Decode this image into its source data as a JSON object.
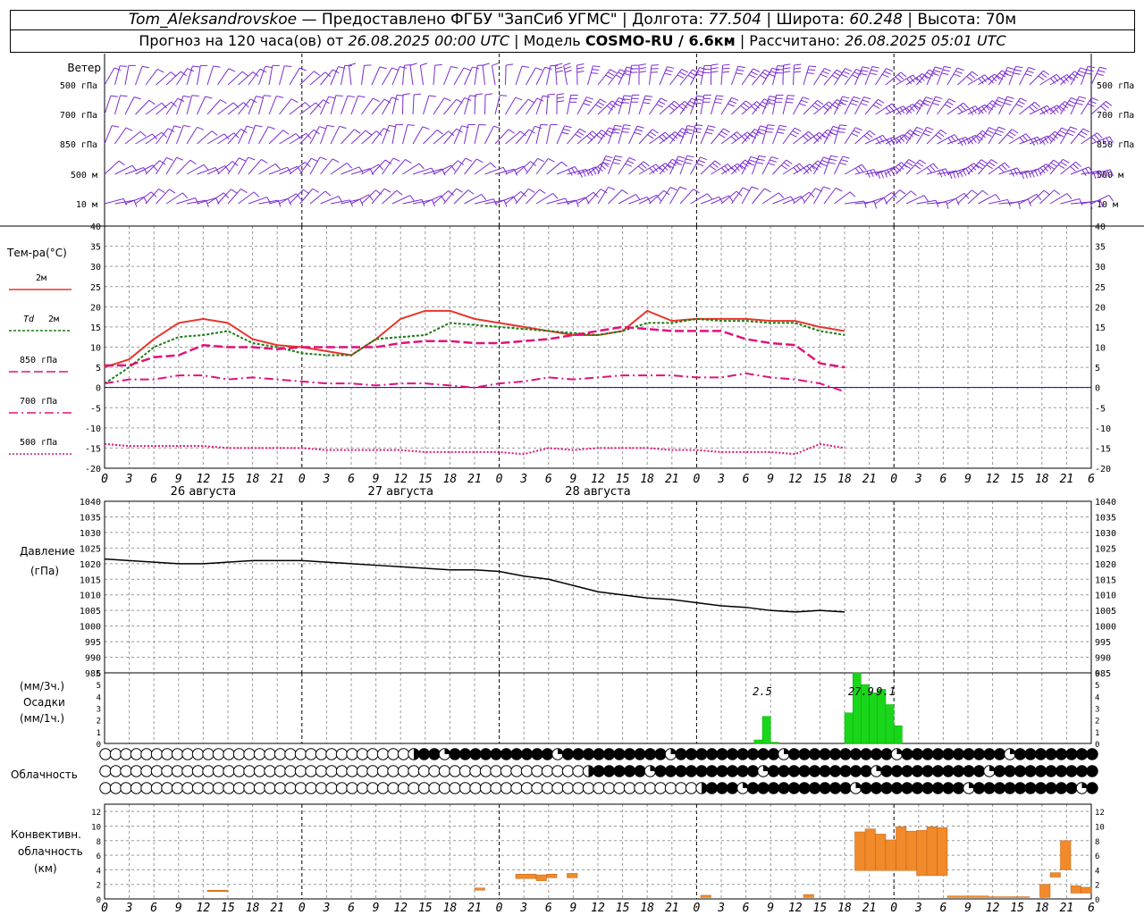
{
  "header": {
    "line1": {
      "station": "Tom_Aleksandrovskoe",
      "provided": "— Предоставлено ФГБУ \"ЗапСиб УГМС\" | Долгота:",
      "lon": "77.504",
      "lat_label": "| Широта:",
      "lat": "60.248",
      "alt_label": "| Высота:",
      "alt": "70м"
    },
    "line2": {
      "forecast_label": "Прогноз на 120 часа(ов) от",
      "forecast_time": "26.08.2025 00:00 UTC",
      "model_label": "| Модель",
      "model": "COSMO-RU / 6.6км",
      "calc_label": "| Рассчитано:",
      "calc_time": "26.08.2025 05:01 UTC"
    }
  },
  "colors": {
    "t2m": "#e8352a",
    "td2m": "#1d7a14",
    "t850": "#e0127a",
    "t700": "#e0127a",
    "t500": "#e0127a",
    "pressure": "#000000",
    "precip": "#1ad61a",
    "conv": "#f08a2a",
    "wind": "#7b2cd0",
    "zero": "#0000cc"
  },
  "wind_panel": {
    "title": "Ветер",
    "levels": [
      "500 гПа",
      "700 гПа",
      "850 гПа",
      "500 м",
      "10 м"
    ]
  },
  "x_axis": {
    "ticks": [
      "0",
      "3",
      "6",
      "9",
      "12",
      "15",
      "18",
      "21"
    ],
    "last_tick": "6",
    "dates": [
      "26 августа",
      "27 августа",
      "28 августа"
    ]
  },
  "icons": {
    "wind": "wind-barb-icon",
    "cloud": "cloud-cover-circle-icon"
  },
  "chart_data": [
    {
      "type": "line",
      "name": "temperature",
      "title": "Тем-ра(°С)",
      "ylim": [
        -20,
        40
      ],
      "yticks": [
        40,
        35,
        30,
        25,
        20,
        15,
        10,
        5,
        0,
        -5,
        -10,
        -15,
        -20
      ],
      "x": [
        0,
        3,
        6,
        9,
        12,
        15,
        18,
        21,
        24,
        27,
        30,
        33,
        36,
        39,
        42,
        45,
        48,
        51,
        54,
        57,
        60,
        63,
        66,
        69,
        72,
        75,
        78,
        81,
        84,
        87,
        90
      ],
      "series": [
        {
          "name": "2м",
          "values": [
            5,
            7,
            12,
            16,
            17,
            16,
            12,
            10.5,
            10,
            9,
            8,
            12,
            17,
            19,
            19,
            17,
            16,
            15,
            14,
            13,
            13,
            14,
            19,
            16.5,
            17,
            17,
            17,
            16.5,
            16.5,
            15,
            14
          ]
        },
        {
          "name": "Td 2м",
          "values": [
            1,
            5,
            10,
            12.5,
            13,
            14,
            11,
            10,
            8.5,
            8,
            8,
            12,
            12.5,
            13,
            16,
            15.5,
            15,
            14.5,
            14,
            13.5,
            13,
            14,
            16,
            16,
            17,
            16.5,
            16.5,
            16,
            16,
            14,
            13
          ]
        },
        {
          "name": "850 гПа",
          "values": [
            5.5,
            5.5,
            7.5,
            8,
            10.5,
            10,
            10,
            9.5,
            10,
            10,
            10,
            10,
            11,
            11.5,
            11.5,
            11,
            11,
            11.5,
            12,
            13,
            14,
            15,
            14.5,
            14,
            14,
            14,
            12,
            11,
            10.5,
            6,
            5
          ]
        },
        {
          "name": "700 гПа",
          "values": [
            1,
            2,
            2,
            3,
            3,
            2,
            2.5,
            2,
            1.5,
            1,
            1,
            0.5,
            1,
            1,
            0.5,
            0,
            1,
            1.5,
            2.5,
            2,
            2.5,
            3,
            3,
            3,
            2.5,
            2.5,
            3.5,
            2.5,
            2,
            1,
            -1
          ]
        },
        {
          "name": "500 гПа",
          "values": [
            -14,
            -14.5,
            -14.5,
            -14.5,
            -14.5,
            -15,
            -15,
            -15,
            -15,
            -15.5,
            -15.5,
            -15.5,
            -15.5,
            -16,
            -16,
            -16,
            -16,
            -16.5,
            -15,
            -15.5,
            -15,
            -15,
            -15,
            -15.5,
            -15.5,
            -16,
            -16,
            -16,
            -16.5,
            -14,
            -15
          ]
        }
      ]
    },
    {
      "type": "line",
      "name": "pressure",
      "title": "Давление",
      "unit": "(гПа)",
      "ylim": [
        985,
        1040
      ],
      "yticks": [
        1040,
        1035,
        1030,
        1025,
        1020,
        1015,
        1010,
        1005,
        1000,
        995,
        990,
        985
      ],
      "x": [
        0,
        3,
        6,
        9,
        12,
        15,
        18,
        21,
        24,
        27,
        30,
        33,
        36,
        39,
        42,
        45,
        48,
        51,
        54,
        57,
        60,
        63,
        66,
        69,
        72,
        75,
        78,
        81,
        84,
        87,
        90
      ],
      "values": [
        1021.5,
        1021,
        1020.5,
        1020,
        1020,
        1020.5,
        1021,
        1021,
        1021,
        1020.5,
        1020,
        1019.5,
        1019,
        1018.5,
        1018,
        1018,
        1017.5,
        1016,
        1015,
        1013,
        1011,
        1010,
        1009,
        1008.5,
        1007.5,
        1006.5,
        1006,
        1005,
        1004.5,
        1005,
        1004.5
      ]
    },
    {
      "type": "bar",
      "name": "precipitation",
      "title": "Осадки",
      "unit_top": "(мм/3ч.)",
      "unit_bottom": "(мм/1ч.)",
      "ylim": [
        0,
        6
      ],
      "yticks": [
        6,
        5,
        4,
        3,
        2,
        1,
        0
      ],
      "x": [
        79,
        80,
        81,
        90,
        91,
        92,
        93,
        94,
        95,
        96
      ],
      "values": [
        0.3,
        2.3,
        0.1,
        2.6,
        6,
        5,
        4.3,
        4.6,
        3.3,
        1.5
      ],
      "labels": [
        {
          "x": 80,
          "text": "2.5"
        },
        {
          "x": 92,
          "text": "27.9"
        },
        {
          "x": 95,
          "text": "9.1"
        }
      ]
    },
    {
      "type": "table",
      "name": "cloudiness",
      "title": "Облачность",
      "rows": 3,
      "steps": 97,
      "onsets": [
        {
          "low": 30,
          "mid": 47,
          "high": 58
        }
      ]
    },
    {
      "type": "bar",
      "name": "convective-cloudiness",
      "title": "Конвективн.",
      "title2": "облачность",
      "unit": "(км)",
      "ylim": [
        0,
        13
      ],
      "yticks": [
        12,
        10,
        8,
        6,
        4,
        2,
        0
      ],
      "bars": [
        [
          10,
          12,
          1,
          1.2
        ],
        [
          36,
          37,
          1.2,
          1.5
        ],
        [
          40,
          42,
          2.8,
          3.4
        ],
        [
          42,
          43,
          2.5,
          3.3
        ],
        [
          43,
          44,
          2.9,
          3.4
        ],
        [
          45,
          46,
          2.9,
          3.5
        ],
        [
          58,
          59,
          0.2,
          0.5
        ],
        [
          68,
          69,
          0.2,
          0.6
        ],
        [
          73,
          74,
          3.9,
          9.2
        ],
        [
          74,
          75,
          3.9,
          9.6
        ],
        [
          75,
          76,
          3.9,
          8.9
        ],
        [
          76,
          77,
          3.9,
          8.1
        ],
        [
          77,
          78,
          3.9,
          9.9
        ],
        [
          78,
          79,
          3.9,
          9.3
        ],
        [
          79,
          80,
          3.2,
          9.4
        ],
        [
          80,
          81,
          3.2,
          9.9
        ],
        [
          81,
          82,
          3.2,
          9.8
        ],
        [
          82,
          86,
          0.2,
          0.4
        ],
        [
          86,
          90,
          0.2,
          0.3
        ],
        [
          91,
          92,
          0.2,
          2
        ],
        [
          92,
          93,
          3,
          3.6
        ],
        [
          93,
          94,
          4,
          8
        ],
        [
          94,
          95,
          0.8,
          1.8
        ],
        [
          95,
          96,
          0.8,
          1.6
        ]
      ]
    }
  ]
}
